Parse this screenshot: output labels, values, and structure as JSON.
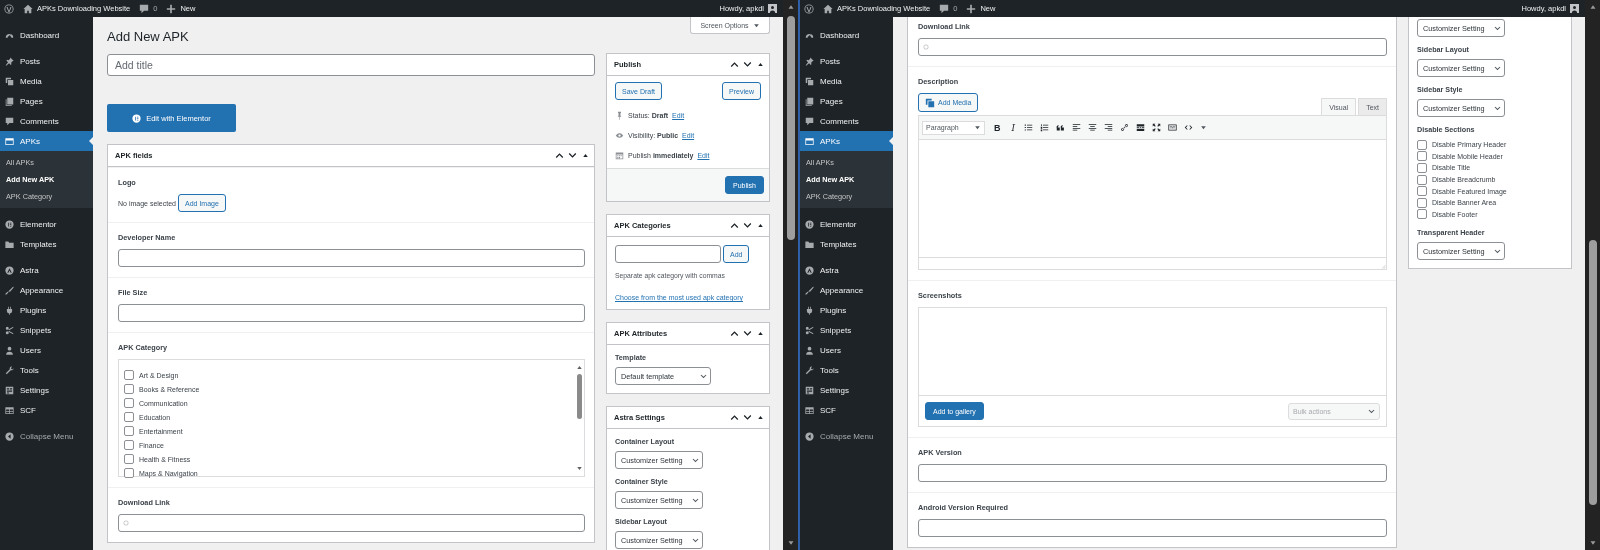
{
  "panes": [
    {
      "admin_bar": {
        "site_title": "APKs Downloading Website",
        "comments": "0",
        "new_label": "New",
        "greeting": "Howdy, apkdl"
      },
      "menu": [
        [
          {
            "label": "Dashboard",
            "selected": false
          }
        ],
        [
          {
            "label": "Posts",
            "selected": false
          },
          {
            "label": "Media",
            "selected": false
          },
          {
            "label": "Pages",
            "selected": false
          },
          {
            "label": "Comments",
            "selected": false
          },
          {
            "label": "APKs",
            "selected": true,
            "children": [
              {
                "label": "All APKs",
                "selected": false
              },
              {
                "label": "Add New APK",
                "selected": true
              },
              {
                "label": "APK Category",
                "selected": false
              }
            ]
          }
        ],
        [
          {
            "label": "Elementor",
            "selected": false
          },
          {
            "label": "Templates",
            "selected": false
          }
        ],
        [
          {
            "label": "Astra",
            "selected": false
          },
          {
            "label": "Appearance",
            "selected": false
          },
          {
            "label": "Plugins",
            "selected": false
          },
          {
            "label": "Snippets",
            "selected": false
          },
          {
            "label": "Users",
            "selected": false
          },
          {
            "label": "Tools",
            "selected": false
          },
          {
            "label": "Settings",
            "selected": false
          },
          {
            "label": "SCF",
            "selected": false
          }
        ]
      ],
      "collapse_label": "Collapse Menu",
      "screen_options": "Screen Options",
      "page_title": "Add New APK",
      "title_placeholder": "Add title",
      "elementor_button": "Edit with Elementor",
      "main_box": {
        "title": "APK fields",
        "fields": [
          {
            "kind": "image",
            "label": "Logo",
            "empty_text": "No image selected",
            "button": "Add Image"
          },
          {
            "kind": "text",
            "label": "Developer Name"
          },
          {
            "kind": "text",
            "label": "File Size"
          },
          {
            "kind": "checklist",
            "label": "APK Category",
            "items": [
              {
                "label": "Art & Design",
                "checked": false
              },
              {
                "label": "Books & Reference",
                "checked": false
              },
              {
                "label": "Communication",
                "checked": false
              },
              {
                "label": "Education",
                "checked": false
              },
              {
                "label": "Entertainment",
                "checked": false
              },
              {
                "label": "Finance",
                "checked": false
              },
              {
                "label": "Health & Fitness",
                "checked": false
              },
              {
                "label": "Maps & Navigation",
                "checked": false
              }
            ]
          },
          {
            "kind": "url",
            "label": "Download Link"
          }
        ]
      },
      "side_boxes": [
        {
          "kind": "publish",
          "title": "Publish",
          "save_draft": "Save Draft",
          "preview": "Preview",
          "rows": [
            {
              "label": "Status:",
              "value": "Draft",
              "link": "Edit"
            },
            {
              "label": "Visibility:",
              "value": "Public",
              "link": "Edit"
            },
            {
              "label": "Publish",
              "value": "immediately",
              "link": "Edit"
            }
          ],
          "publish_button": "Publish"
        },
        {
          "kind": "tags",
          "title": "APK Categories",
          "add_button": "Add",
          "hint": "Separate apk category with commas",
          "link": "Choose from the most used apk category"
        },
        {
          "kind": "attributes",
          "title": "APK Attributes",
          "label": "Template",
          "select": "Default template"
        },
        {
          "kind": "settings",
          "title": "Astra Settings",
          "items": [
            {
              "kind": "select",
              "label": "Container Layout",
              "value": "Customizer Setting"
            },
            {
              "kind": "select",
              "label": "Container Style",
              "value": "Customizer Setting"
            },
            {
              "kind": "select",
              "label": "Sidebar Layout",
              "value": "Customizer Setting"
            }
          ]
        }
      ]
    },
    {
      "admin_bar": {
        "site_title": "APKs Downloading Website",
        "comments": "0",
        "new_label": "New",
        "greeting": "Howdy, apkdl"
      },
      "menu": [
        [
          {
            "label": "Dashboard",
            "selected": false
          }
        ],
        [
          {
            "label": "Posts",
            "selected": false
          },
          {
            "label": "Media",
            "selected": false
          },
          {
            "label": "Pages",
            "selected": false
          },
          {
            "label": "Comments",
            "selected": false
          },
          {
            "label": "APKs",
            "selected": true,
            "children": [
              {
                "label": "All APKs",
                "selected": false
              },
              {
                "label": "Add New APK",
                "selected": true
              },
              {
                "label": "APK Category",
                "selected": false
              }
            ]
          }
        ],
        [
          {
            "label": "Elementor",
            "selected": false
          },
          {
            "label": "Templates",
            "selected": false
          }
        ],
        [
          {
            "label": "Astra",
            "selected": false
          },
          {
            "label": "Appearance",
            "selected": false
          },
          {
            "label": "Plugins",
            "selected": false
          },
          {
            "label": "Snippets",
            "selected": false
          },
          {
            "label": "Users",
            "selected": false
          },
          {
            "label": "Tools",
            "selected": false
          },
          {
            "label": "Settings",
            "selected": false
          },
          {
            "label": "SCF",
            "selected": false
          }
        ]
      ],
      "collapse_label": "Collapse Menu",
      "main_box": {
        "fields": [
          {
            "kind": "url",
            "label": "Download Link"
          },
          {
            "kind": "editor",
            "label": "Description",
            "add_media": "Add Media",
            "tabs": [
              {
                "label": "Visual",
                "selected": true
              },
              {
                "label": "Text",
                "selected": false
              }
            ],
            "format": "Paragraph",
            "toolbar_text": [
              "B",
              "I"
            ]
          },
          {
            "kind": "gallery",
            "label": "Screenshots",
            "button": "Add to gallery",
            "bulk": "Bulk actions"
          },
          {
            "kind": "text",
            "label": "APK Version"
          },
          {
            "kind": "text",
            "label": "Android Version Required"
          }
        ]
      },
      "side_boxes": [
        {
          "kind": "settings",
          "items": [
            {
              "kind": "select",
              "value": "Customizer Setting"
            },
            {
              "kind": "select",
              "label": "Sidebar Layout",
              "value": "Customizer Setting"
            },
            {
              "kind": "select",
              "label": "Sidebar Style",
              "value": "Customizer Setting"
            },
            {
              "kind": "checks",
              "label": "Disable Sections",
              "items": [
                {
                  "label": "Disable Primary Header",
                  "checked": false
                },
                {
                  "label": "Disable Mobile Header",
                  "checked": false
                },
                {
                  "label": "Disable Title",
                  "checked": false
                },
                {
                  "label": "Disable Breadcrumb",
                  "checked": false
                },
                {
                  "label": "Disable Featured Image",
                  "checked": false
                },
                {
                  "label": "Disable Banner Area",
                  "checked": false
                },
                {
                  "label": "Disable Footer",
                  "checked": false
                }
              ]
            },
            {
              "kind": "select",
              "label": "Transparent Header",
              "value": "Customizer Setting"
            }
          ]
        }
      ]
    }
  ]
}
